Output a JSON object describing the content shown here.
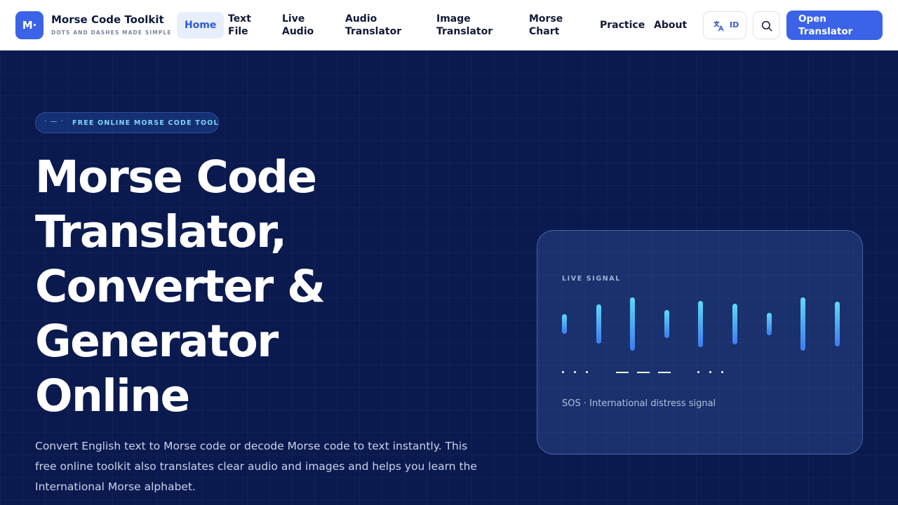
{
  "brand": {
    "logo": "M·",
    "name": "Morse Code Toolkit",
    "tagline": "DOTS AND DASHES MADE SIMPLE"
  },
  "nav": {
    "home": "Home",
    "text_file": [
      "Text",
      "File"
    ],
    "live_audio": [
      "Live",
      "Audio"
    ],
    "audio_translator": [
      "Audio",
      "Translator"
    ],
    "image_translator": [
      "Image",
      "Translator"
    ],
    "morse_chart": [
      "Morse",
      "Chart"
    ],
    "practice": "Practice",
    "about": "About",
    "active": "Home"
  },
  "header_actions": {
    "language": "ID",
    "language_icon": "translate-icon",
    "search_icon": "search-icon",
    "cta": [
      "Open",
      "Translator"
    ]
  },
  "hero": {
    "pill_icon": "· — ·",
    "pill_label": "FREE ONLINE MORSE CODE TOOL",
    "title_lines": [
      "Morse Code",
      "Translator,",
      "Converter &",
      "Generator",
      "Online"
    ],
    "description": "Convert English text to Morse code or decode Morse code to text instantly. This free online toolkit also translates clear audio and images and helps you learn the International Morse alphabet."
  },
  "signal": {
    "label": "LIVE SIGNAL",
    "waveform_levels": [
      0.37,
      0.73,
      1.0,
      0.53,
      0.88,
      0.77,
      0.41,
      0.99,
      0.83
    ],
    "morse_pattern": "... --- ...",
    "caption": "SOS · International distress signal"
  },
  "colors": {
    "primary": "#3a63e8",
    "hero_bg": "#0a1a4f",
    "accent_cyan": "#5fd8f7"
  }
}
